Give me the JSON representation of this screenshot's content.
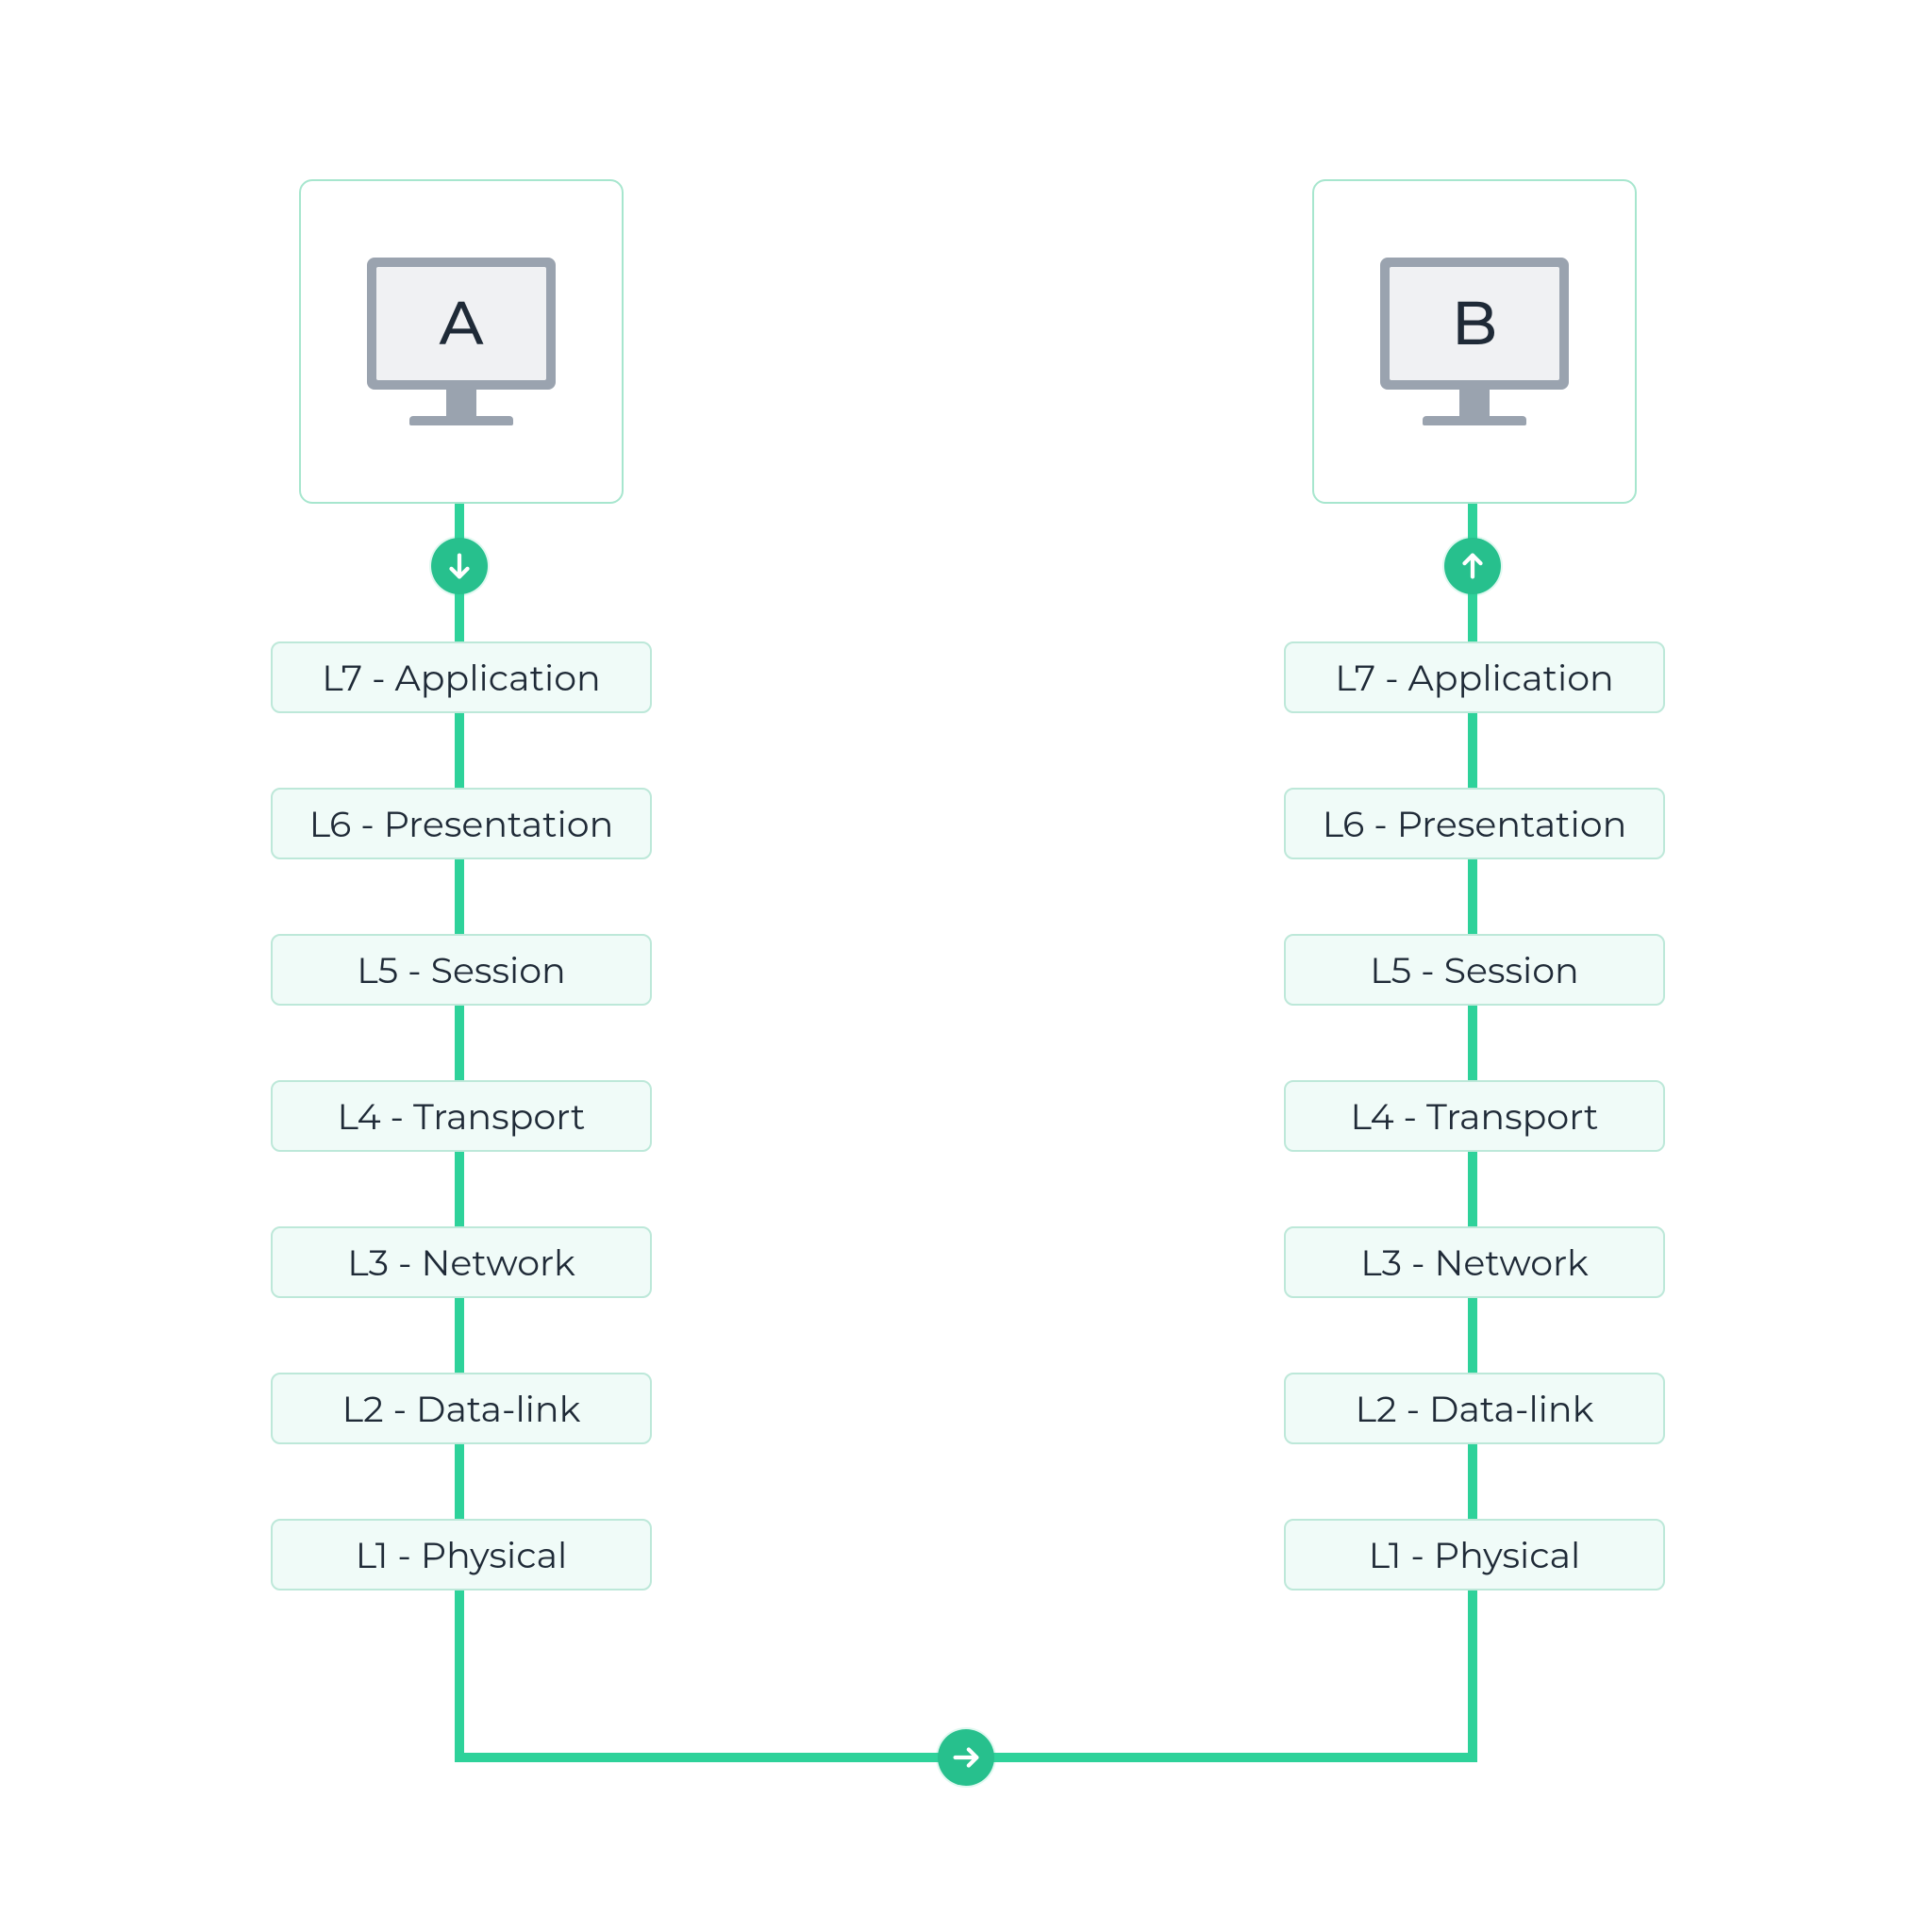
{
  "nodes": {
    "a": {
      "label": "A"
    },
    "b": {
      "label": "B"
    }
  },
  "arrows": {
    "down": "down",
    "right": "right",
    "up": "up"
  },
  "layers": {
    "a": [
      "L7 - Application",
      "L6 - Presentation",
      "L5 - Session",
      "L4 - Transport",
      "L3 - Network",
      "L2 - Data-link",
      "L1 - Physical"
    ],
    "b": [
      "L7 - Application",
      "L6 - Presentation",
      "L5 - Session",
      "L4 - Transport",
      "L3 - Network",
      "L2 - Data-link",
      "L1 - Physical"
    ]
  },
  "colors": {
    "accent": "#2ed29a",
    "layerBg": "#f0fbf8",
    "layerBorder": "#bde8d9",
    "nodeBorder": "#a7e6ce",
    "text": "#1f2a37"
  }
}
